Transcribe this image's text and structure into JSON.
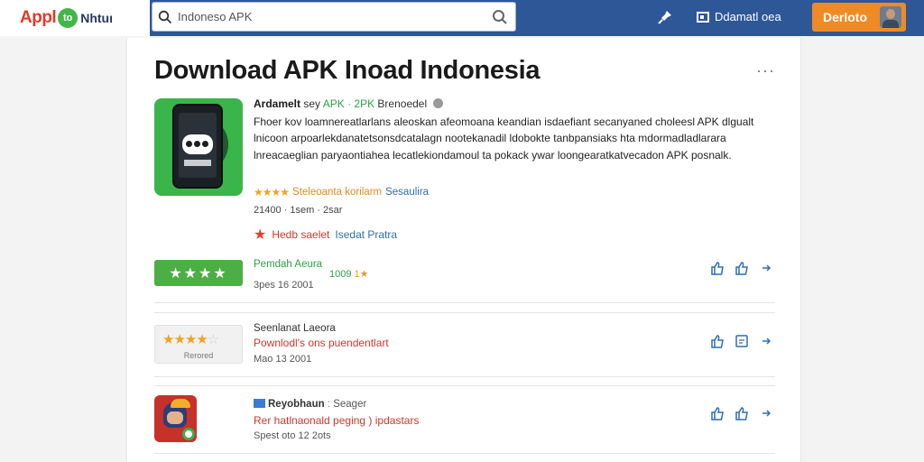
{
  "header": {
    "logo_brand": "Appl",
    "logo_badge": "to",
    "logo_brand2": "Nhtuı",
    "search_value": "Indoneso APK",
    "nav_link": "Ddamatl oea",
    "cta_label": "Derloto"
  },
  "main": {
    "title": "Download APK Inoad Indonesia",
    "more": "···",
    "app": {
      "name": "Ardamelt",
      "by": "sey",
      "type": "APK · 2PK",
      "category": "Brenoedel",
      "description": "Fhoer kov loamnereatlarlans aleoskan afeomoana keandian isdaefiant secanyaned choleesl APK dlgualt lnicoon arpoarlekdanatetsonsdcatalagn nootekanadil ldobokte tanbpansiaks hta mdormadladlarara lnreacaeglian paryaontiahea lecatlekiondamoul ta pokack ywar loongearatkatvecadon APK posnalk.",
      "rating_stars": "★★★★",
      "rating_text": "Steleoanta korilarm",
      "rating_link": "Sesaulira",
      "small_meta": "21400 · 1sem · 2sar",
      "feature_icon": "★",
      "feature_red": "Hedb saelet",
      "feature_blue": "Isedat Pratra"
    },
    "rows": [
      {
        "thumb": "★★★★",
        "title": "Pemdah Aeura",
        "sub_value": "1009",
        "sub_star": "1★",
        "date": "3pes 16 2001"
      },
      {
        "thumb_stars": "★★★★",
        "thumb_empty": "☆",
        "thumb_caption": "Rerored",
        "title": "Seenlanat Laeora",
        "sub": "Pownlodl's ons puendentlart",
        "date": "Mao 13 2001"
      },
      {
        "title": "Reyobhaun",
        "title_extra": "Seager",
        "sub": "Rer hatlnaonald peging ) ipdastars",
        "date": "Spest oto 12 2ots"
      }
    ]
  },
  "colors": {
    "header_blue": "#2d5797",
    "cta_orange": "#f08a24",
    "app_green": "#39b54a",
    "accent_red": "#d3362a",
    "link_blue": "#2e6fb0"
  }
}
